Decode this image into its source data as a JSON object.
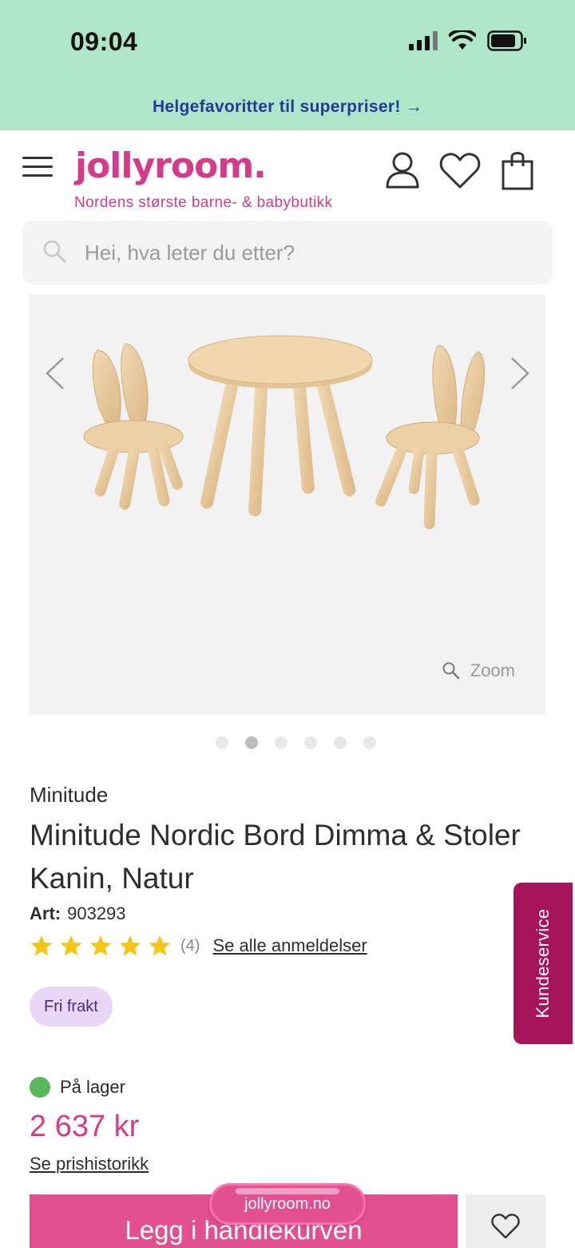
{
  "status_bar": {
    "time": "09:04"
  },
  "promo": {
    "text": "Helgefavoritter til superpriser! →"
  },
  "header": {
    "logo": "jollyroom.",
    "tagline": "Nordens største barne- & babybutikk"
  },
  "search": {
    "placeholder": "Hei, hva leter du etter?"
  },
  "gallery": {
    "zoom_label": "Zoom",
    "total_images": 6,
    "active_index": 1
  },
  "product": {
    "brand": "Minitude",
    "title": "Minitude Nordic Bord Dimma & Stoler Kanin, Natur",
    "art_label": "Art:",
    "art_number": "903293",
    "rating_stars": 5,
    "review_count": "(4)",
    "reviews_link": "Se alle anmeldelser",
    "badge": "Fri frakt",
    "stock": "På lager",
    "price": "2 637 kr",
    "price_history_link": "Se prishistorikk",
    "add_to_cart": "Legg i handlekurven"
  },
  "side_tab": {
    "label": "Kundeservice"
  },
  "browser": {
    "url": "jollyroom.no"
  },
  "colors": {
    "brand_pink": "#d63a8a",
    "promo_green": "#b0e6c8",
    "cta_pink": "#e2508f",
    "service_tab": "#a8145a",
    "star_yellow": "#f5c518",
    "stock_green": "#58b85a"
  }
}
